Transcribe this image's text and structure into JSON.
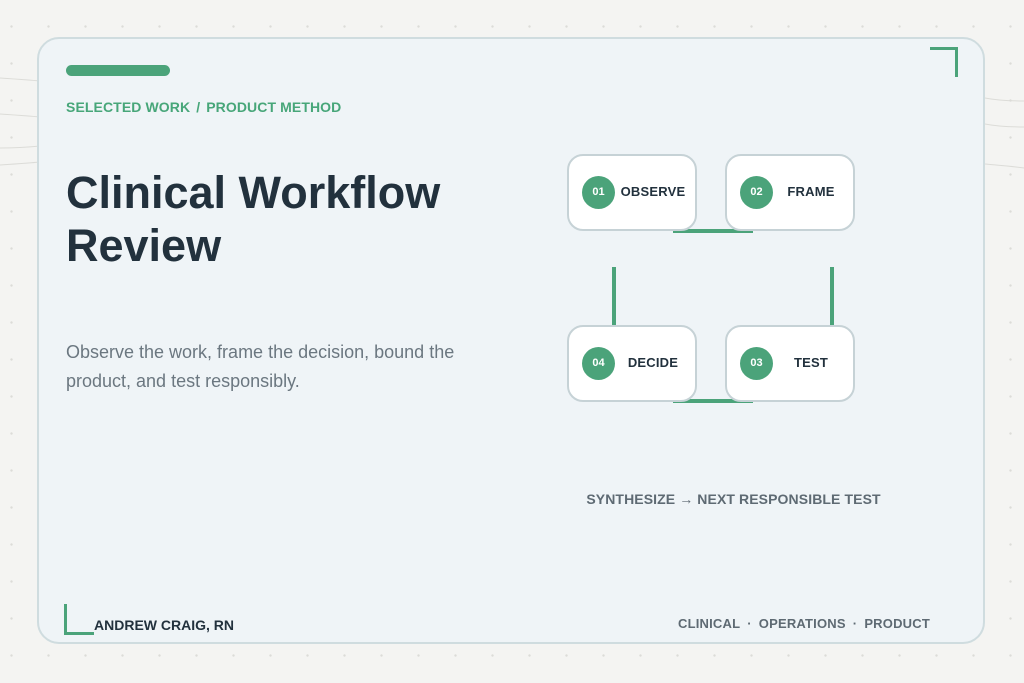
{
  "breadcrumb": {
    "section": "SELECTED WORK",
    "separator": "/",
    "page": "PRODUCT METHOD"
  },
  "title": "Clinical Workflow Review",
  "subtitle": "Observe the work, frame the decision, bound the product, and test responsibly.",
  "steps": [
    {
      "num": "01",
      "label": "OBSERVE"
    },
    {
      "num": "02",
      "label": "FRAME"
    },
    {
      "num": "03",
      "label": "TEST"
    },
    {
      "num": "04",
      "label": "DECIDE"
    }
  ],
  "caption": "SYNTHESIZE → NEXT RESPONSIBLE TEST",
  "footer": {
    "author": "ANDREW CRAIG, RN",
    "tags": [
      "CLINICAL",
      "OPERATIONS",
      "PRODUCT"
    ],
    "tag_separator": "·"
  },
  "colors": {
    "accent": "#4ba37a",
    "title": "#22313d",
    "muted": "#6b7780",
    "card_background": "#eff4f7",
    "page_background": "#f4f4f2"
  }
}
